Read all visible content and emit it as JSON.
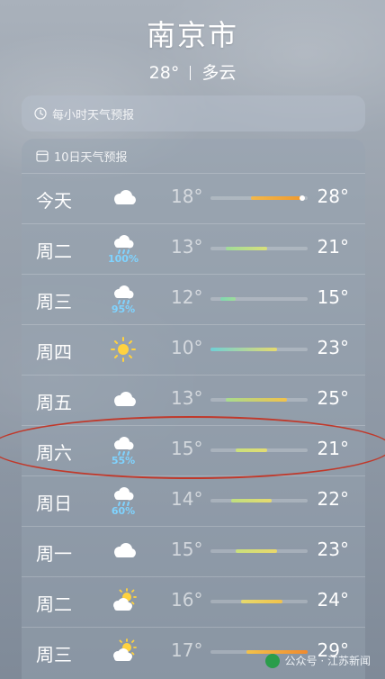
{
  "header": {
    "city": "南京市",
    "current_temp": "28°",
    "condition": "多云"
  },
  "hourly_card": {
    "icon": "clock-icon",
    "label": "每小时天气预报"
  },
  "daily_card": {
    "icon": "calendar-icon",
    "label": "10日天气预报",
    "scale": {
      "min": 10,
      "max": 29
    },
    "days": [
      {
        "day": "今天",
        "icon": "cloud",
        "precip": "",
        "low": "18°",
        "high": "28°",
        "low_val": 18,
        "high_val": 28,
        "colors": [
          "#f2b84a",
          "#f09a2e"
        ],
        "current_dot": 28
      },
      {
        "day": "周二",
        "icon": "rain",
        "precip": "100%",
        "low": "13°",
        "high": "21°",
        "low_val": 13,
        "high_val": 21,
        "colors": [
          "#9fdc9a",
          "#d9e07a"
        ]
      },
      {
        "day": "周三",
        "icon": "rain",
        "precip": "95%",
        "low": "12°",
        "high": "15°",
        "low_val": 12,
        "high_val": 15,
        "colors": [
          "#7fd7b3",
          "#9fdc9a"
        ]
      },
      {
        "day": "周四",
        "icon": "sun",
        "precip": "",
        "low": "10°",
        "high": "23°",
        "low_val": 10,
        "high_val": 23,
        "colors": [
          "#6fd0d6",
          "#e6da6e"
        ]
      },
      {
        "day": "周五",
        "icon": "cloud",
        "precip": "",
        "low": "13°",
        "high": "25°",
        "low_val": 13,
        "high_val": 25,
        "colors": [
          "#a7dc90",
          "#f2c24a"
        ]
      },
      {
        "day": "周六",
        "icon": "rain",
        "precip": "55%",
        "low": "15°",
        "high": "21°",
        "low_val": 15,
        "high_val": 21,
        "colors": [
          "#c9e07d",
          "#e3dc72"
        ]
      },
      {
        "day": "周日",
        "icon": "rain",
        "precip": "60%",
        "low": "14°",
        "high": "22°",
        "low_val": 14,
        "high_val": 22,
        "colors": [
          "#bfdf80",
          "#e6da6e"
        ]
      },
      {
        "day": "周一",
        "icon": "cloud",
        "precip": "",
        "low": "15°",
        "high": "23°",
        "low_val": 15,
        "high_val": 23,
        "colors": [
          "#c9e07d",
          "#ead86a"
        ]
      },
      {
        "day": "周二",
        "icon": "sun-cloud",
        "precip": "",
        "low": "16°",
        "high": "24°",
        "low_val": 16,
        "high_val": 24,
        "colors": [
          "#e6da6e",
          "#f2c24a"
        ]
      },
      {
        "day": "周三",
        "icon": "sun-cloud",
        "precip": "",
        "low": "17°",
        "high": "29°",
        "low_val": 17,
        "high_val": 29,
        "colors": [
          "#f2c24a",
          "#f08a2e"
        ]
      }
    ]
  },
  "watermark": {
    "text": "公众号 · 江苏新闻"
  }
}
